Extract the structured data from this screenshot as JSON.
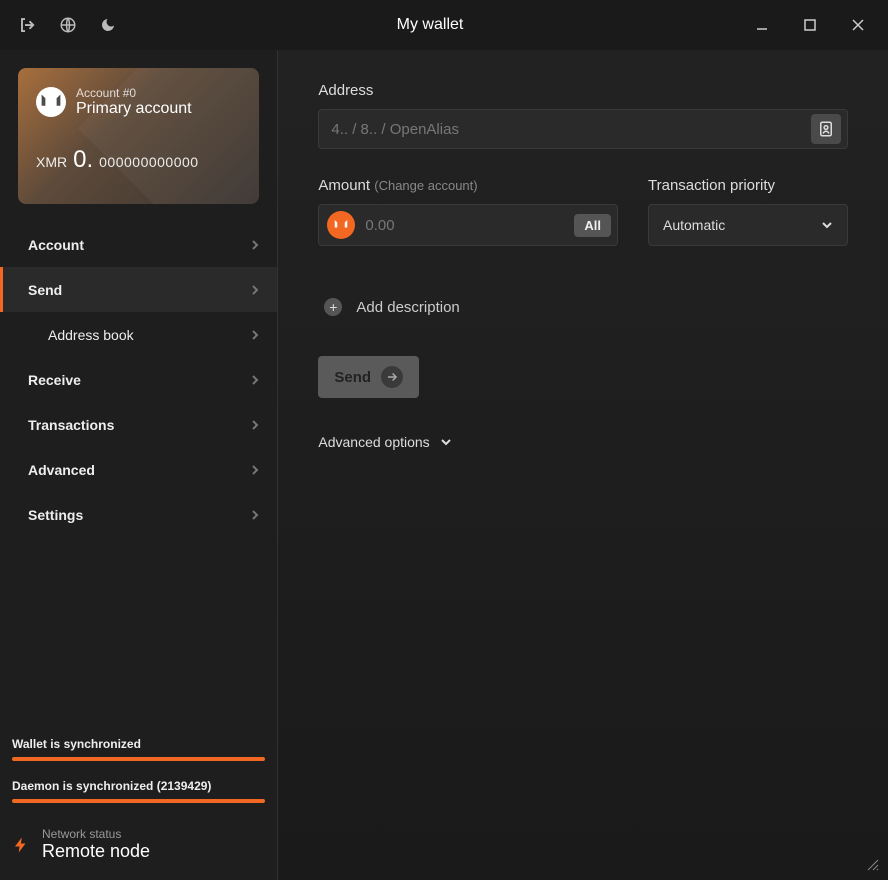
{
  "titlebar": {
    "title": "My wallet"
  },
  "account": {
    "number_label": "Account #0",
    "name": "Primary account",
    "currency": "XMR",
    "balance_int": "0.",
    "balance_dec": "000000000000"
  },
  "nav": {
    "account": "Account",
    "send": "Send",
    "address_book": "Address book",
    "receive": "Receive",
    "transactions": "Transactions",
    "advanced": "Advanced",
    "settings": "Settings"
  },
  "sync": {
    "wallet": "Wallet is synchronized",
    "daemon": "Daemon is synchronized (2139429)"
  },
  "network": {
    "label": "Network status",
    "value": "Remote node"
  },
  "send": {
    "address_label": "Address",
    "address_placeholder": "4.. / 8.. / OpenAlias",
    "amount_label": "Amount",
    "change_account": "(Change account)",
    "amount_placeholder": "0.00",
    "all_btn": "All",
    "priority_label": "Transaction priority",
    "priority_value": "Automatic",
    "add_description": "Add description",
    "send_btn": "Send",
    "advanced_options": "Advanced options"
  }
}
